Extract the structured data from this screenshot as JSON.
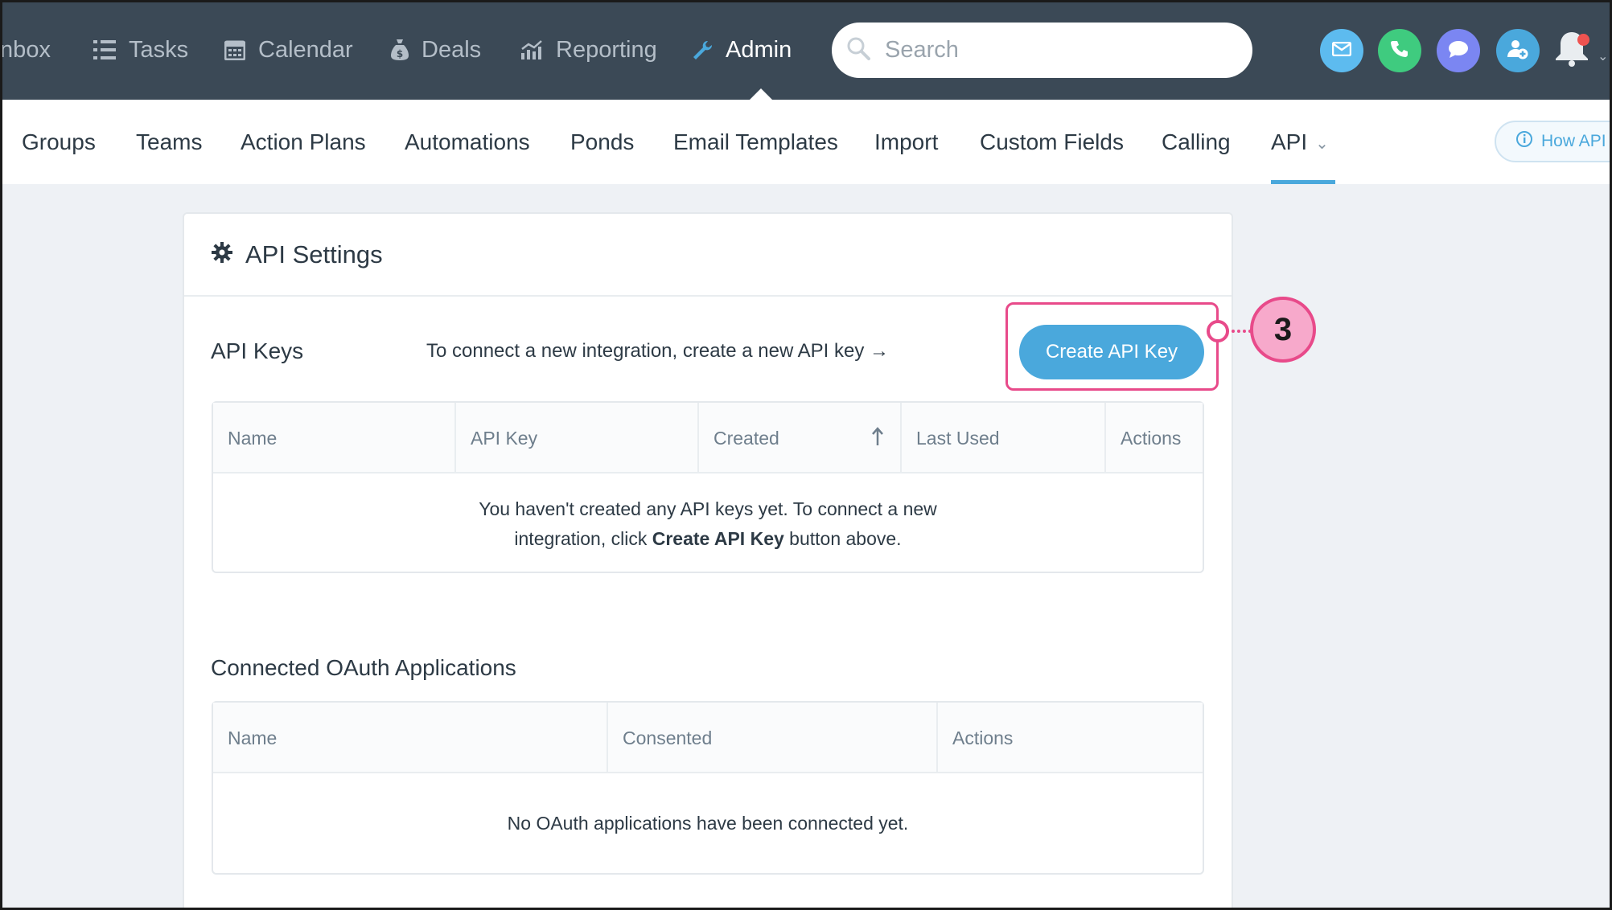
{
  "topnav": {
    "items": [
      {
        "label": "Inbox",
        "icon": "inbox-icon"
      },
      {
        "label": "Tasks",
        "icon": "list-icon"
      },
      {
        "label": "Calendar",
        "icon": "calendar-icon"
      },
      {
        "label": "Deals",
        "icon": "moneybag-icon"
      },
      {
        "label": "Reporting",
        "icon": "chart-icon"
      },
      {
        "label": "Admin",
        "icon": "wrench-icon",
        "active": true
      }
    ],
    "search_placeholder": "Search",
    "action_icons": [
      "email-icon",
      "phone-icon",
      "chat-icon",
      "add-person-icon",
      "bell-icon"
    ]
  },
  "subnav": {
    "items": [
      "Groups",
      "Teams",
      "Action Plans",
      "Automations",
      "Ponds",
      "Email Templates",
      "Import",
      "Custom Fields",
      "Calling",
      "API"
    ],
    "active": "API",
    "help_label": "How API w"
  },
  "card": {
    "title": "API Settings",
    "api_keys": {
      "label": "API Keys",
      "hint": "To connect a new integration, create a new API key →",
      "button": "Create API Key",
      "columns": [
        "Name",
        "API Key",
        "Created",
        "Last Used",
        "Actions"
      ],
      "empty_line1": "You haven't created any API keys yet. To connect a new",
      "empty_line2_pre": "integration, click ",
      "empty_line2_bold": "Create API Key",
      "empty_line2_post": " button above."
    },
    "oauth": {
      "label": "Connected OAuth Applications",
      "columns": [
        "Name",
        "Consented",
        "Actions"
      ],
      "empty": "No OAuth applications have been connected yet."
    }
  },
  "callout": {
    "number": "3"
  },
  "colors": {
    "nav_bg": "#3b4956",
    "accent": "#4aa8dc",
    "callout": "#e84a8a",
    "email": "#5dbbef",
    "phone": "#3fcb7f",
    "chat": "#7b86f2",
    "add_person": "#4aa8dc"
  }
}
